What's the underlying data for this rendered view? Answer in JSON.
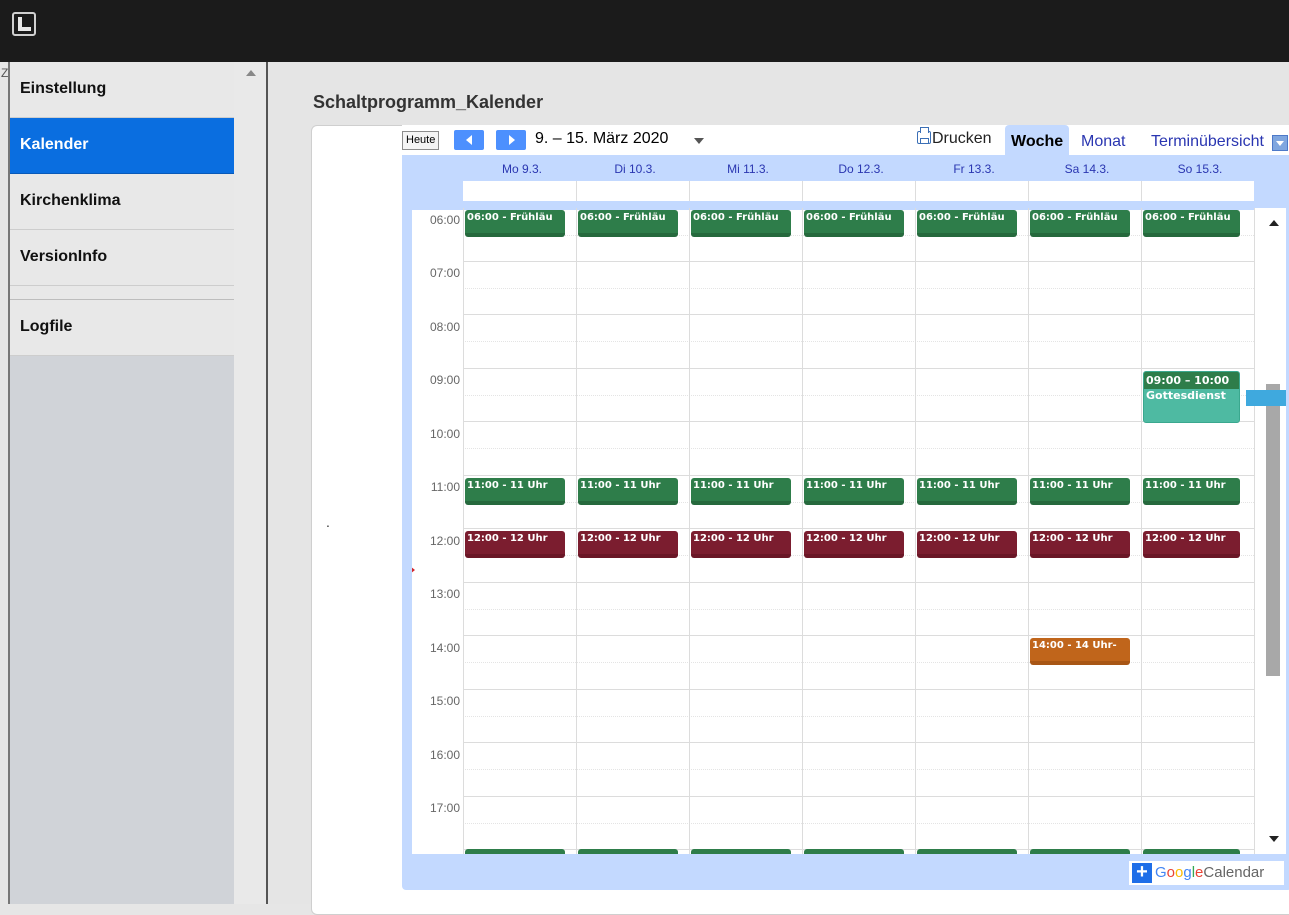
{
  "app": {
    "side_fragment": "Z"
  },
  "sidebar": {
    "items": [
      {
        "label": "Einstellung"
      },
      {
        "label": "Kalender"
      },
      {
        "label": "Kirchenklima"
      },
      {
        "label": "VersionInfo"
      },
      {
        "label": "Logfile"
      }
    ]
  },
  "main": {
    "page_title": "Schaltprogramm_Kalender",
    "dot": "."
  },
  "calendar": {
    "today_label": "Heute",
    "range_label": "9. – 15. März 2020",
    "print_label": "Drucken",
    "tabs": {
      "week": "Woche",
      "month": "Monat",
      "agenda": "Terminübersicht"
    },
    "days": [
      "Mo 9.3.",
      "Di 10.3.",
      "Mi 11.3.",
      "Do 12.3.",
      "Fr 13.3.",
      "Sa 14.3.",
      "So 15.3."
    ],
    "hours": [
      "06:00",
      "07:00",
      "08:00",
      "09:00",
      "10:00",
      "11:00",
      "12:00",
      "13:00",
      "14:00",
      "15:00",
      "16:00",
      "17:00"
    ],
    "events": {
      "morning": "06:00 - Frühläu",
      "eleven": "11:00 - 11 Uhr",
      "noon": "12:00 - 12 Uhr",
      "sat_afternoon": "14:00 - 14 Uhr-",
      "sun_service_time": "09:00 – 10:00",
      "sun_service_title": "Gottesdienst"
    },
    "colors": {
      "green": "#2e7d4a",
      "red": "#7b1d2f",
      "orange": "#c0651b",
      "teal": "#4ebaa2",
      "accent": "#0a6ee0"
    },
    "footer": {
      "plus": "+",
      "google_g": "G",
      "google_o1": "o",
      "google_o2": "o",
      "google_g2": "g",
      "google_l": "l",
      "google_e": "e",
      "calendar_word": "Calendar"
    }
  }
}
